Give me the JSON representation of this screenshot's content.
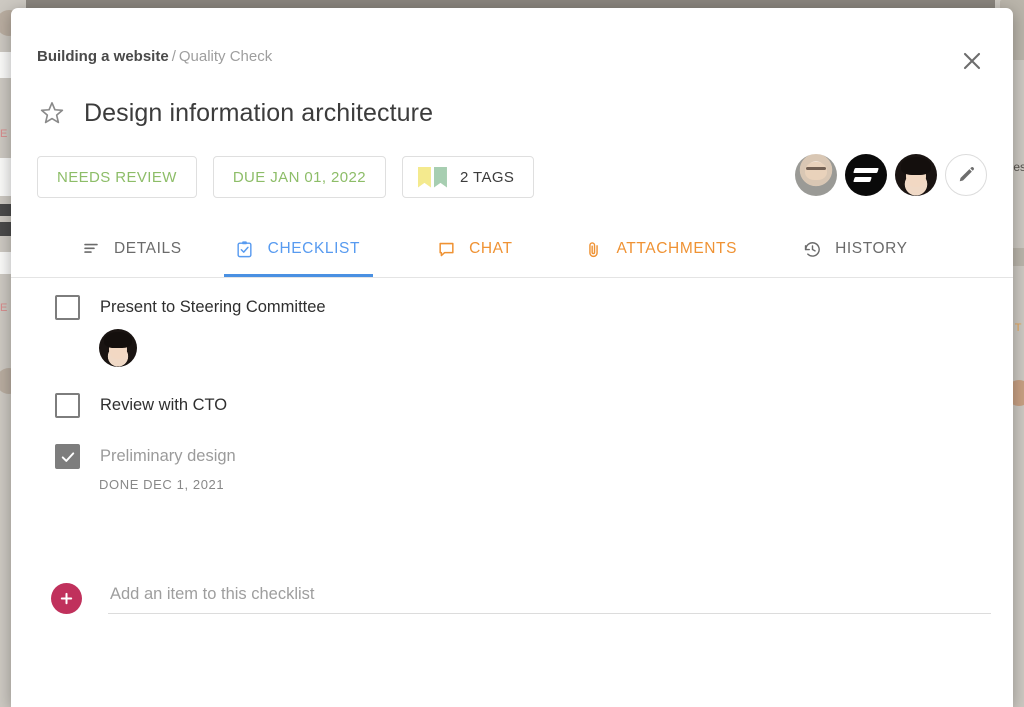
{
  "modal": {
    "breadcrumb": {
      "project": "Building a website",
      "separator": "/",
      "list": "Quality Check"
    },
    "close_label": "Close",
    "title": "Design information architecture",
    "star_label": "Favorite",
    "chips": [
      {
        "id": "status",
        "label": "NEEDS REVIEW"
      },
      {
        "id": "due",
        "label": "DUE JAN 01, 2022"
      },
      {
        "id": "tags",
        "label": "2 TAGS"
      }
    ],
    "people": [
      {
        "id": "avatar-1",
        "kind": "photo-m",
        "name": "Assignee 1"
      },
      {
        "id": "avatar-2",
        "kind": "logo",
        "name": "Team logo"
      },
      {
        "id": "avatar-3",
        "kind": "photo-w",
        "name": "Assignee 2"
      }
    ],
    "edit_label": "Edit",
    "tabs": [
      {
        "id": "details",
        "label": "DETAILS",
        "icon": "list-icon",
        "active": false
      },
      {
        "id": "checklist",
        "label": "CHECKLIST",
        "icon": "clipboard-check-icon",
        "active": true
      },
      {
        "id": "chat",
        "label": "CHAT",
        "icon": "speech-bubble-icon",
        "active": false
      },
      {
        "id": "attachments",
        "label": "ATTACHMENTS",
        "icon": "paperclip-icon",
        "active": false
      },
      {
        "id": "history",
        "label": "HISTORY",
        "icon": "clock-rewind-icon",
        "active": false
      }
    ],
    "checklist": {
      "items": [
        {
          "label": "Present to Steering Committee",
          "checked": false,
          "assignee": true,
          "meta": ""
        },
        {
          "label": "Review with CTO",
          "checked": false,
          "assignee": false,
          "meta": ""
        },
        {
          "label": "Preliminary design",
          "checked": true,
          "assignee": false,
          "meta": "DONE DEC 1, 2021"
        }
      ],
      "add_placeholder": "Add an item to this checklist",
      "add_value": "",
      "add_button_label": "+"
    }
  },
  "colors": {
    "accent_blue": "#4a90e2",
    "tab_blue": "#589bf0",
    "tab_orange": "#ef9233",
    "chip_green": "#8dbd68",
    "add_crimson": "#c0315c",
    "tag_yellow": "#f4ea8e",
    "tag_green": "#a7ceb1",
    "checkbox_gray": "#7d7d7d"
  },
  "background": {
    "fragments": [
      "E",
      "E",
      "es",
      "T"
    ]
  }
}
